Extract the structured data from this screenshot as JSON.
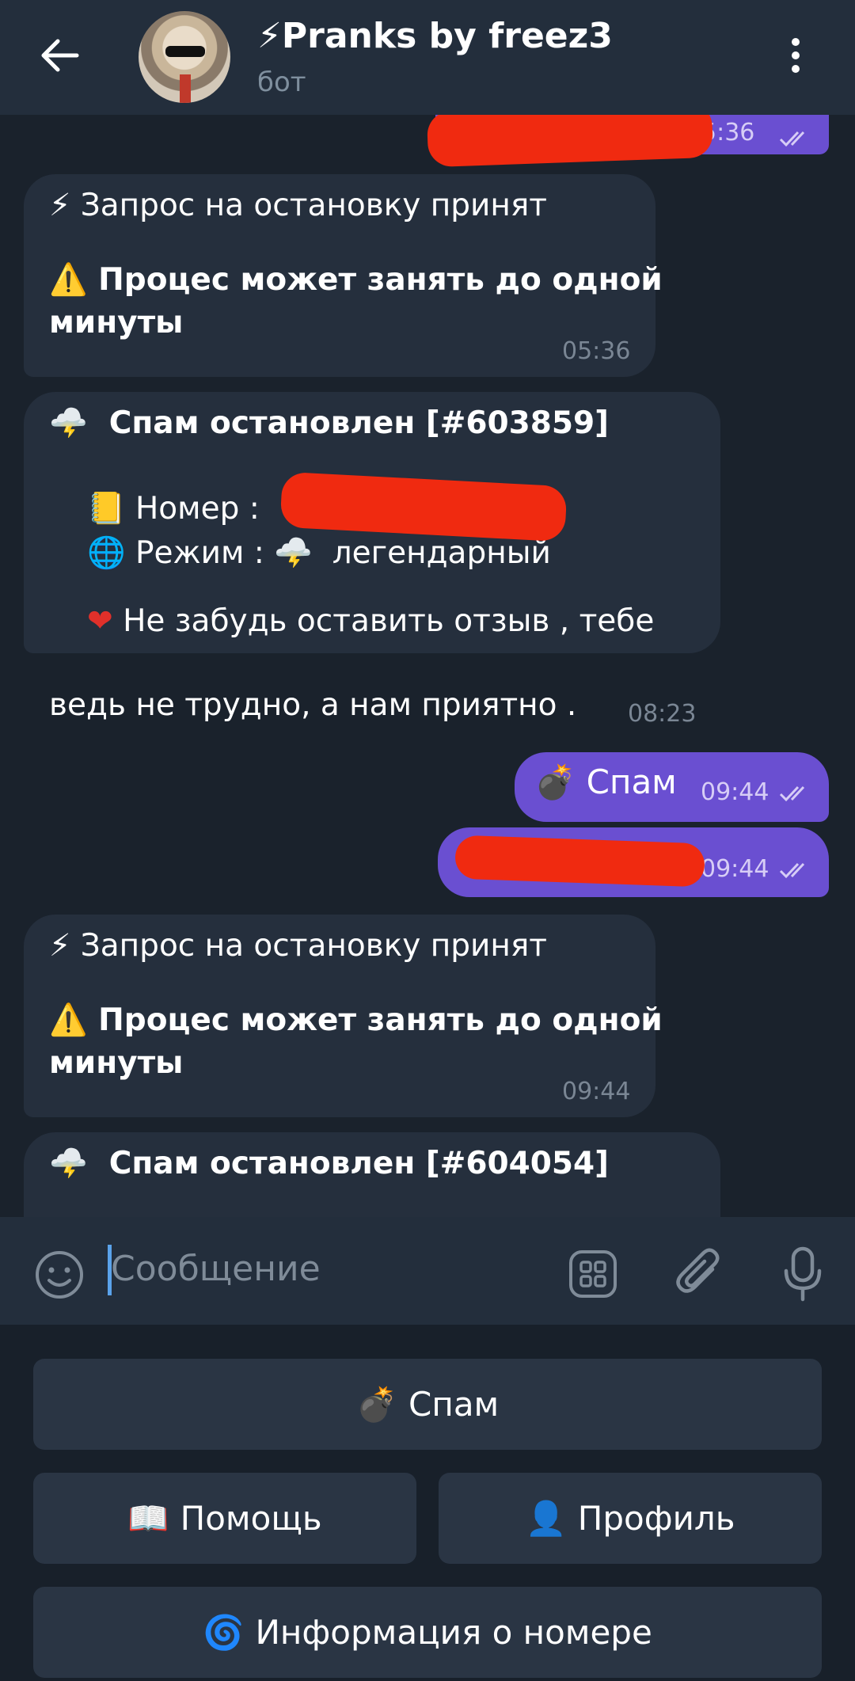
{
  "header": {
    "title": "⚡Pranks by freez3",
    "subtitle": "бот"
  },
  "messages": [
    {
      "time": "05:36",
      "partial_time": "5:36"
    },
    {
      "line1": "⚡ Запрос на остановку принят",
      "line2": "⚠️ Процес может занять до одной",
      "line3": "минуты",
      "time": "05:36"
    },
    {
      "line1": "Спам остановлен [#603859]",
      "number_label": "Номер :",
      "mode_label": "Режим :",
      "mode_value": "легендарный",
      "line_review1": "Не забудь оставить отзыв , тебе",
      "line_review2": "ведь не трудно, а нам приятно .",
      "time": "08:23"
    },
    {
      "text": "Спам",
      "time": "09:44"
    },
    {
      "time": "09:44"
    },
    {
      "line1": "⚡ Запрос на остановку принят",
      "line2": "⚠️ Процес может занять до одной",
      "line3": "минуты",
      "time": "09:44"
    },
    {
      "line1": "Спам остановлен [#604054]"
    }
  ],
  "input": {
    "placeholder": "Сообщение"
  },
  "keyboard": {
    "spam": "Спам",
    "help": "Помощь",
    "profile": "Профиль",
    "info": "Информация о номере"
  },
  "colors": {
    "accent": "#6a4fd1",
    "header": "#232e3c",
    "bubble_in": "#252f3d",
    "redaction": "#f02a10"
  }
}
